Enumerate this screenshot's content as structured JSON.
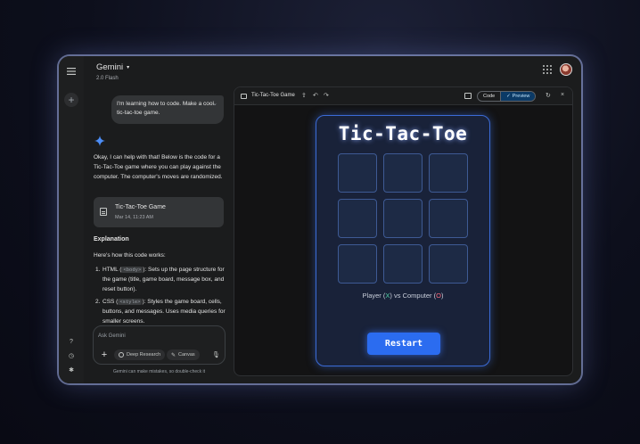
{
  "header": {
    "model_name": "Gemini",
    "model_version": "2.0 Flash"
  },
  "chat": {
    "user_message": "I'm learning how to code. Make a cool tic-tac-toe game.",
    "response_text": "Okay, I can help with that! Below is the code for a Tic-Tac-Toe game where you can play against the computer. The computer's moves are randomized.",
    "card": {
      "title": "Tic-Tac-Toe Game",
      "date": "Mar 14, 11:23 AM"
    },
    "explanation_heading": "Explanation",
    "explanation_intro": "Here's how this code works:",
    "list": [
      {
        "num": "1.",
        "pre": "HTML (",
        "code": "<body>",
        "post": "): Sets up the page structure for the game (title, game board, message box, and reset button)."
      },
      {
        "num": "2.",
        "pre": "CSS (",
        "code": "<style>",
        "post": "): Styles the game board, cells, buttons, and messages. Uses media queries for smaller screens."
      }
    ]
  },
  "input": {
    "placeholder": "Ask Gemini",
    "deep_research_label": "Deep Research",
    "canvas_label": "Canvas",
    "disclaimer": "Gemini can make mistakes, so double-check it"
  },
  "canvas": {
    "title": "Tic-Tac-Toe Game",
    "code_label": "Code",
    "preview_label": "Preview"
  },
  "game": {
    "title": "Tic-Tac-Toe",
    "status_player": "Player (",
    "status_x": "X",
    "status_mid": ") vs Computer (",
    "status_o": "O",
    "status_end": ")",
    "restart_label": "Restart",
    "cells": [
      "",
      "",
      "",
      "",
      "",
      "",
      "",
      "",
      ""
    ]
  },
  "colors": {
    "accent": "#2b6cf0",
    "x_color": "#4fd1a5",
    "o_color": "#ff6b7d",
    "preview_active": "#0b3a66"
  },
  "icons": [
    "menu-icon",
    "plus-icon",
    "chevron-down-icon",
    "apps-icon",
    "gemini-spark-icon",
    "document-icon",
    "help-icon",
    "history-icon",
    "settings-icon",
    "mic-icon",
    "share-icon",
    "undo-icon",
    "refresh-icon",
    "close-icon",
    "check-icon",
    "layout-icon"
  ]
}
